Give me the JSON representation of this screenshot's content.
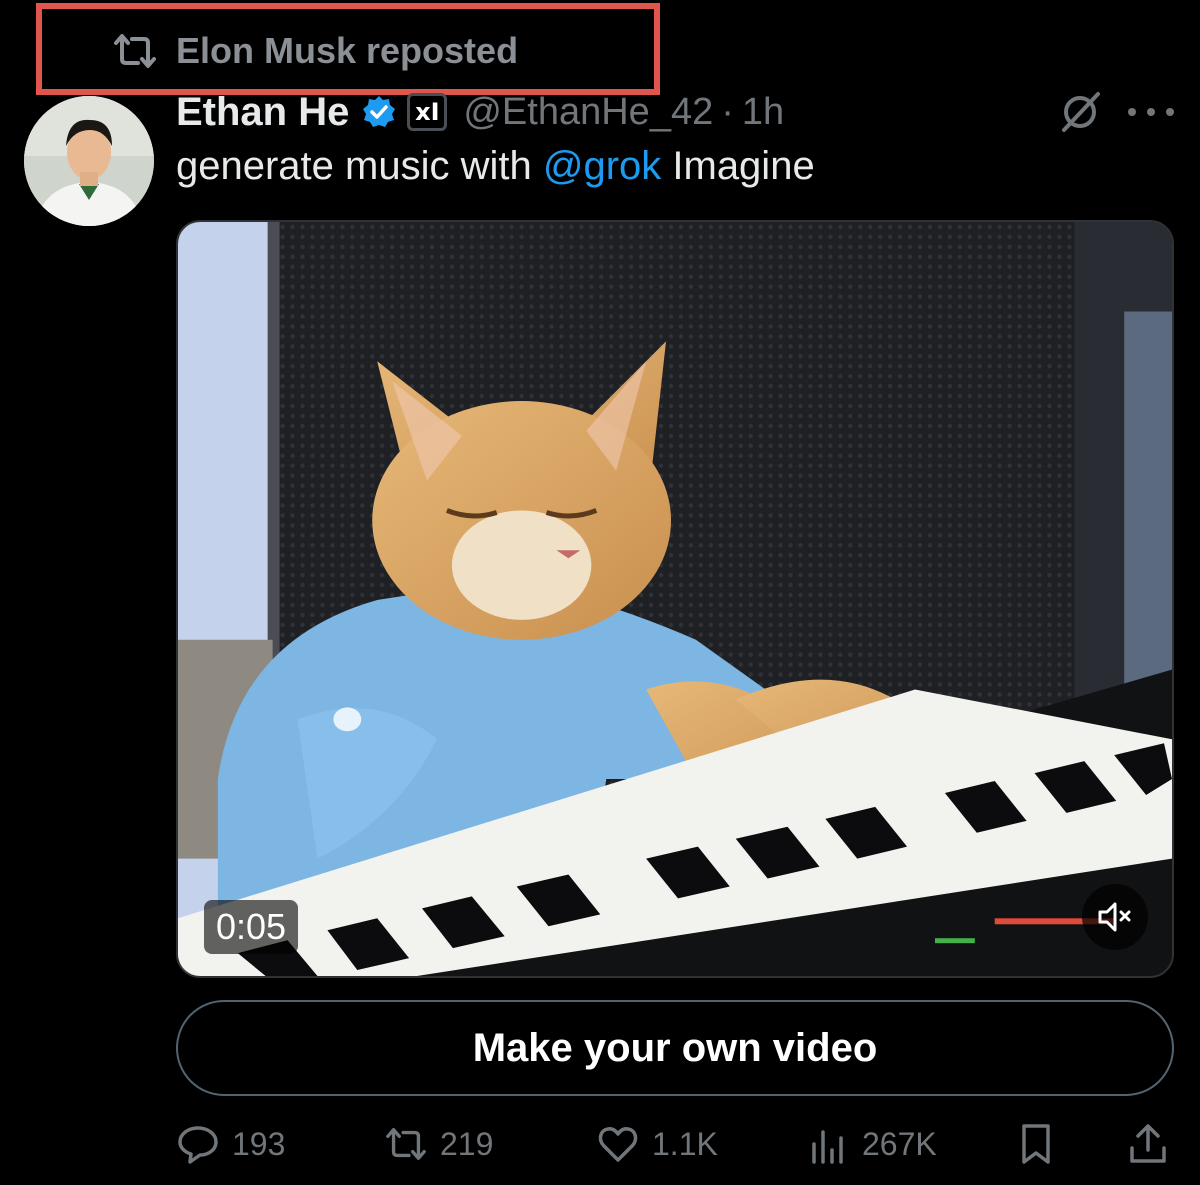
{
  "repost": {
    "label": "Elon Musk reposted",
    "icon": "retweet-icon",
    "highlight_color": "#e0564c"
  },
  "author": {
    "name": "Ethan He",
    "verified_icon": "verified-badge-icon",
    "affiliate_badge": "xI",
    "handle": "@EthanHe_42",
    "separator": "·",
    "time": "1h"
  },
  "tweet": {
    "text_before": "generate music with ",
    "mention": "@grok",
    "text_after": " Imagine"
  },
  "media": {
    "duration": "0:05",
    "mute_icon": "volume-muted-icon"
  },
  "cta": {
    "label": "Make your own video"
  },
  "actions": {
    "replies": "193",
    "reposts": "219",
    "likes": "1.1K",
    "views": "267K"
  },
  "colors": {
    "background": "#000000",
    "link": "#1d9bf0",
    "muted": "#71767b",
    "verified": "#1d9bf0"
  }
}
